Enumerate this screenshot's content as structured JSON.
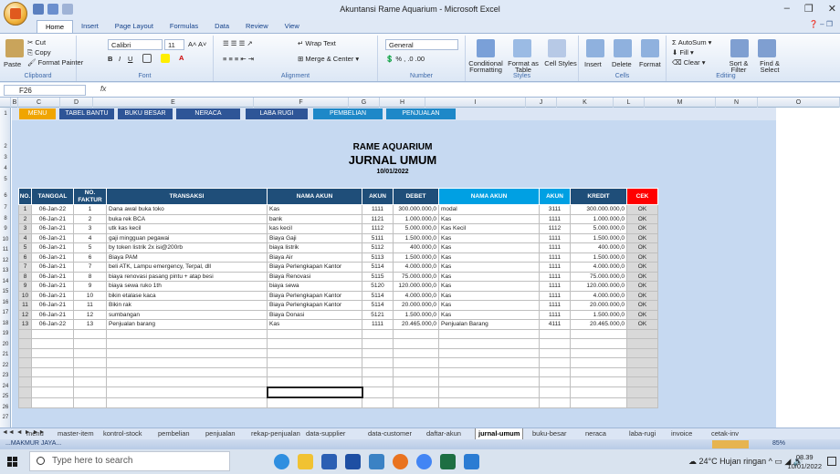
{
  "window": {
    "title": "Akuntansi Rame Aquarium - Microsoft Excel"
  },
  "ribbon": {
    "tabs": [
      "Home",
      "Insert",
      "Page Layout",
      "Formulas",
      "Data",
      "Review",
      "View"
    ],
    "clipboard": {
      "label": "Clipboard",
      "paste": "Paste",
      "cut": "Cut",
      "copy": "Copy",
      "format_painter": "Format Painter"
    },
    "font": {
      "label": "Font",
      "name": "Calibri",
      "size": "11"
    },
    "alignment": {
      "label": "Alignment",
      "wrap": "Wrap Text",
      "merge": "Merge & Center"
    },
    "number": {
      "label": "Number",
      "format": "General"
    },
    "styles": {
      "label": "Styles",
      "conditional": "Conditional Formatting",
      "format_table": "Format as Table",
      "cell_styles": "Cell Styles"
    },
    "cells": {
      "label": "Cells",
      "insert": "Insert",
      "delete": "Delete",
      "format": "Format"
    },
    "editing": {
      "label": "Editing",
      "autosum": "AutoSum",
      "fill": "Fill",
      "clear": "Clear",
      "sort": "Sort & Filter",
      "find": "Find & Select"
    }
  },
  "formula_bar": {
    "name_box": "F26",
    "fx": "fx"
  },
  "columns": [
    "B",
    "C",
    "D",
    "E",
    "F",
    "G",
    "H",
    "I",
    "J",
    "K",
    "L",
    "M",
    "N",
    "O"
  ],
  "sheet_menu": [
    "MENU",
    "TABEL BANTU",
    "BUKU BESAR",
    "NERACA",
    "LABA RUGI",
    "PEMBELIAN",
    "PENJUALAN"
  ],
  "header": {
    "company": "RAME AQUARIUM",
    "title": "JURNAL UMUM",
    "date": "10/01/2022"
  },
  "table": {
    "columns": [
      "NO.",
      "TANGGAL",
      "NO. FAKTUR",
      "TRANSAKSI",
      "NAMA AKUN",
      "AKUN",
      "DEBET",
      "NAMA AKUN",
      "AKUN",
      "KREDIT",
      "CEK"
    ],
    "rows": [
      [
        "1",
        "06-Jan-22",
        "1",
        "Dana awal buka toko",
        "Kas",
        "1111",
        "300.000.000,0",
        "modal",
        "3111",
        "300.000.000,0",
        "OK"
      ],
      [
        "2",
        "06-Jan-21",
        "2",
        "buka rek BCA",
        "bank",
        "1121",
        "1.000.000,0",
        "Kas",
        "1111",
        "1.000.000,0",
        "OK"
      ],
      [
        "3",
        "06-Jan-21",
        "3",
        "utk kas kecil",
        "kas kecil",
        "1112",
        "5.000.000,0",
        "Kas Kecil",
        "1112",
        "5.000.000,0",
        "OK"
      ],
      [
        "4",
        "06-Jan-21",
        "4",
        "gaji mingguan pegawai",
        "Biaya Gaji",
        "5111",
        "1.500.000,0",
        "Kas",
        "1111",
        "1.500.000,0",
        "OK"
      ],
      [
        "5",
        "06-Jan-21",
        "5",
        "by token listrik 2x isi@200rb",
        "biaya listrik",
        "5112",
        "400.000,0",
        "Kas",
        "1111",
        "400.000,0",
        "OK"
      ],
      [
        "6",
        "06-Jan-21",
        "6",
        "Biaya PAM",
        "Biaya Air",
        "5113",
        "1.500.000,0",
        "Kas",
        "1111",
        "1.500.000,0",
        "OK"
      ],
      [
        "7",
        "06-Jan-21",
        "7",
        "beli ATK, Lampu emergency, Terpal, dll",
        "Biaya Perlengkapan Kantor",
        "5114",
        "4.000.000,0",
        "Kas",
        "1111",
        "4.000.000,0",
        "OK"
      ],
      [
        "8",
        "06-Jan-21",
        "8",
        "biaya renovasi pasang pintu + atap besi",
        "Biaya Renovasi",
        "5115",
        "75.000.000,0",
        "Kas",
        "1111",
        "75.000.000,0",
        "OK"
      ],
      [
        "9",
        "06-Jan-21",
        "9",
        "biaya sewa ruko 1th",
        "biaya sewa",
        "5120",
        "120.000.000,0",
        "Kas",
        "1111",
        "120.000.000,0",
        "OK"
      ],
      [
        "10",
        "06-Jan-21",
        "10",
        "bikin etalase kaca",
        "Biaya Perlengkapan Kantor",
        "5114",
        "4.000.000,0",
        "Kas",
        "1111",
        "4.000.000,0",
        "OK"
      ],
      [
        "11",
        "06-Jan-21",
        "11",
        "Bikin rak",
        "Biaya Perlengkapan Kantor",
        "5114",
        "20.000.000,0",
        "Kas",
        "1111",
        "20.000.000,0",
        "OK"
      ],
      [
        "12",
        "06-Jan-21",
        "12",
        "sumbangan",
        "Biaya Donasi",
        "5121",
        "1.500.000,0",
        "Kas",
        "1111",
        "1.500.000,0",
        "OK"
      ],
      [
        "13",
        "06-Jan-22",
        "13",
        "Penjualan barang",
        "Kas",
        "1111",
        "20.465.000,0",
        "Penjualan Barang",
        "4111",
        "20.465.000,0",
        "OK"
      ]
    ]
  },
  "sheet_tabs": [
    "menu",
    "master-item",
    "kontrol-stock",
    "pembelian",
    "penjualan",
    "rekap-penjualan",
    "data-supplier",
    "data-customer",
    "daftar-akun",
    "jurnal-umum",
    "buku-besar",
    "neraca",
    "laba-rugi",
    "invoice",
    "cetak-inv"
  ],
  "active_sheet": "jurnal-umum",
  "status": {
    "left": "...MAKMUR JAYA...",
    "zoom": "85%"
  },
  "taskbar": {
    "search_placeholder": "Type here to search",
    "weather": "24°C  Hujan ringan",
    "time": "08.39",
    "date": "10/01/2022"
  }
}
